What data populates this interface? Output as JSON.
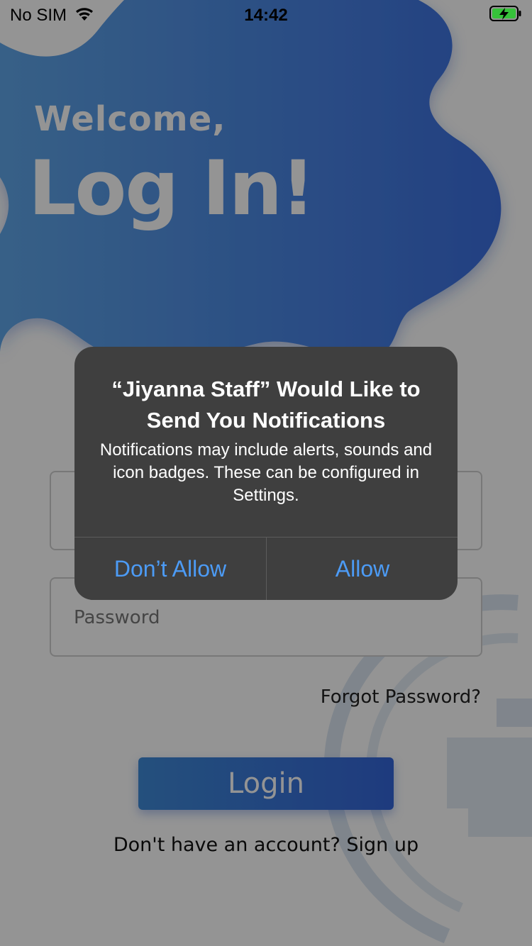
{
  "status_bar": {
    "carrier": "No SIM",
    "time": "14:42",
    "wifi_icon": "wifi-icon",
    "battery_icon": "battery-charging-icon"
  },
  "login_screen": {
    "welcome": "Welcome,",
    "title": "Log In!",
    "password_placeholder": "Password",
    "forgot_password": "Forgot Password?",
    "login_button": "Login",
    "signup_prompt": "Don't have an account? Sign up"
  },
  "notification_alert": {
    "title": "“Jiyanna Staff” Would Like to Send You Notifications",
    "message": "Notifications may include alerts, sounds and icon badges. These can be configured in Settings.",
    "deny_label": "Don’t Allow",
    "allow_label": "Allow"
  },
  "colors": {
    "blob_start": "#5fa6e8",
    "blob_end": "#3b6ee0",
    "button_gradient_start": "#3f8ad8",
    "button_gradient_end": "#3566d9",
    "alert_background": "#3f3f3f",
    "alert_button_text": "#4c9bf5"
  }
}
